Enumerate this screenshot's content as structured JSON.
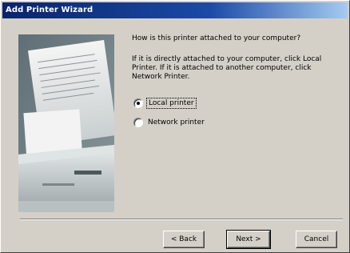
{
  "window": {
    "title": "Add Printer Wizard"
  },
  "image": {
    "description": "printer-illustration"
  },
  "main": {
    "question": "How is this printer attached to your computer?",
    "info": "If it is directly attached to your computer, click Local Printer. If it is attached to another computer, click Network Printer.",
    "options": [
      {
        "label": "Local printer",
        "selected": true
      },
      {
        "label": "Network printer",
        "selected": false
      }
    ]
  },
  "buttons": {
    "back": "< Back",
    "next": "Next >",
    "cancel": "Cancel"
  },
  "colors": {
    "titlebar_start": "#0a246a",
    "titlebar_end": "#a6caf0",
    "dialog_bg": "#d4d0c8"
  }
}
